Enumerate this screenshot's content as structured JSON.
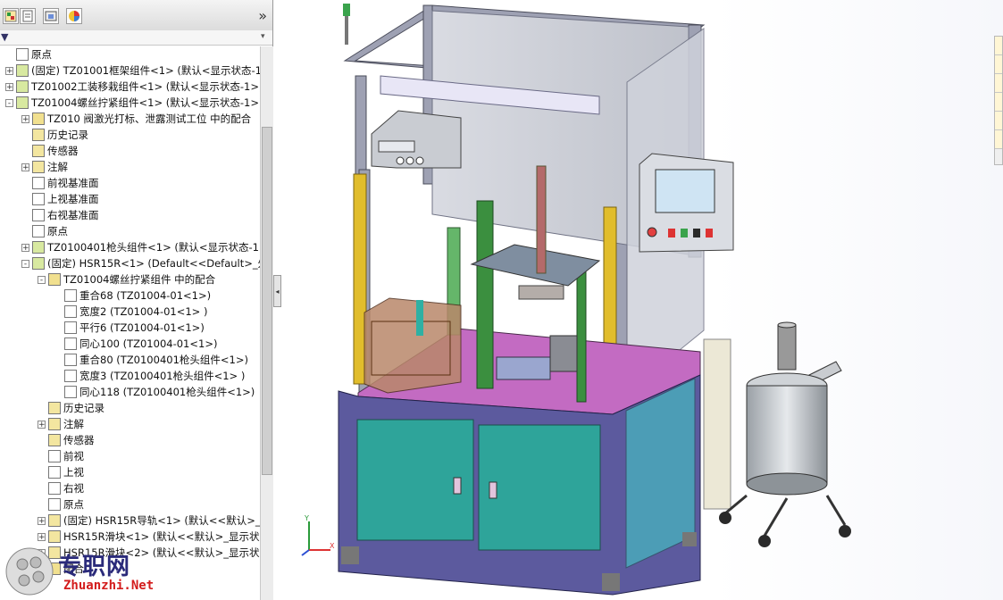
{
  "feature_tree": {
    "items": [
      {
        "text": "原点",
        "depth": 0,
        "icon": "origin-icon"
      },
      {
        "text": "(固定) TZ01001框架组件<1> (默认<显示状态-1>",
        "depth": 0,
        "icon": "subassembly-icon",
        "expander": "+"
      },
      {
        "text": "TZ01002工装移栽组件<1> (默认<显示状态-1>)",
        "depth": 0,
        "icon": "subassembly-icon",
        "expander": "+"
      },
      {
        "text": "TZ01004螺丝拧紧组件<1> (默认<显示状态-1>)",
        "depth": 0,
        "icon": "subassembly-icon",
        "expander": "-"
      },
      {
        "text": "TZ010 阀激光打标、泄露测试工位 中的配合",
        "depth": 1,
        "icon": "mates-folder-icon",
        "expander": "+"
      },
      {
        "text": "历史记录",
        "depth": 1,
        "icon": "history-icon"
      },
      {
        "text": "传感器",
        "depth": 1,
        "icon": "sensor-icon"
      },
      {
        "text": "注解",
        "depth": 1,
        "icon": "annotation-icon",
        "expander": "+"
      },
      {
        "text": "前视基准面",
        "depth": 1,
        "icon": "plane-icon"
      },
      {
        "text": "上视基准面",
        "depth": 1,
        "icon": "plane-icon"
      },
      {
        "text": "右视基准面",
        "depth": 1,
        "icon": "plane-icon"
      },
      {
        "text": "原点",
        "depth": 1,
        "icon": "origin-icon"
      },
      {
        "text": "TZ0100401枪头组件<1> (默认<显示状态-1>",
        "depth": 1,
        "icon": "subassembly-icon",
        "expander": "+"
      },
      {
        "text": "(固定) HSR15R<1> (Default<<Default>_外观",
        "depth": 1,
        "icon": "subassembly-icon",
        "expander": "-"
      },
      {
        "text": "TZ01004螺丝拧紧组件 中的配合",
        "depth": 2,
        "icon": "mates-folder-icon",
        "expander": "-"
      },
      {
        "text": "重合68 (TZ01004-01<1>)",
        "depth": 3,
        "icon": "coincident-mate-icon"
      },
      {
        "text": "宽度2 (TZ01004-01<1> )",
        "depth": 3,
        "icon": "width-mate-icon"
      },
      {
        "text": "平行6 (TZ01004-01<1>)",
        "depth": 3,
        "icon": "parallel-mate-icon"
      },
      {
        "text": "同心100 (TZ01004-01<1>)",
        "depth": 3,
        "icon": "concentric-mate-icon"
      },
      {
        "text": "重合80 (TZ0100401枪头组件<1>)",
        "depth": 3,
        "icon": "coincident-mate-icon"
      },
      {
        "text": "宽度3 (TZ0100401枪头组件<1> )",
        "depth": 3,
        "icon": "width-mate-icon"
      },
      {
        "text": "同心118 (TZ0100401枪头组件<1>)",
        "depth": 3,
        "icon": "concentric-mate-icon"
      },
      {
        "text": "历史记录",
        "depth": 2,
        "icon": "history-icon"
      },
      {
        "text": "注解",
        "depth": 2,
        "icon": "annotation-icon",
        "expander": "+"
      },
      {
        "text": "传感器",
        "depth": 2,
        "icon": "sensor-icon"
      },
      {
        "text": "前视",
        "depth": 2,
        "icon": "plane-icon"
      },
      {
        "text": "上视",
        "depth": 2,
        "icon": "plane-icon"
      },
      {
        "text": "右视",
        "depth": 2,
        "icon": "plane-icon"
      },
      {
        "text": "原点",
        "depth": 2,
        "icon": "origin-icon"
      },
      {
        "text": "(固定) HSR15R导轨<1> (默认<<默认>_显",
        "depth": 2,
        "icon": "part-icon",
        "expander": "+"
      },
      {
        "text": "HSR15R滑块<1> (默认<<默认>_显示状",
        "depth": 2,
        "icon": "part-icon",
        "expander": "+"
      },
      {
        "text": "HSR15R滑块<2> (默认<<默认>_显示状",
        "depth": 2,
        "icon": "part-icon",
        "expander": "+"
      },
      {
        "text": "配合",
        "depth": 2,
        "icon": "mates-folder-icon"
      }
    ]
  },
  "watermark": {
    "title": "专职网",
    "url": "Zhuanzhi.Net"
  },
  "triad": {
    "x": "X",
    "y": "Y",
    "z": "Z"
  },
  "colors": {
    "frame": "#8c8fa6",
    "cabinet": "#2aa39a",
    "tabletop": "#c76cc4",
    "panel_back": "#a7aab6"
  }
}
